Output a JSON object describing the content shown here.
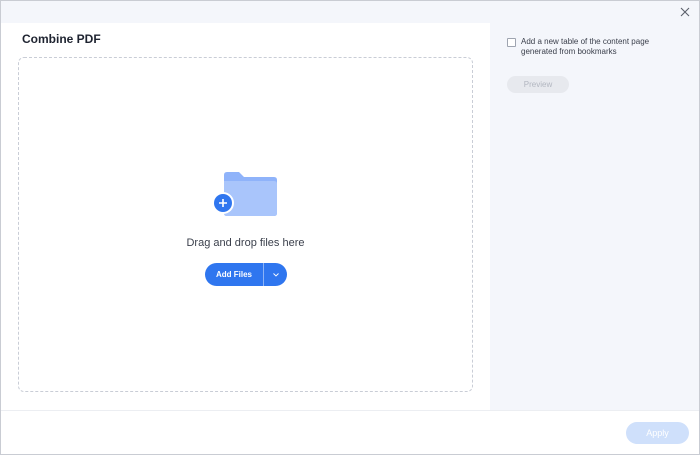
{
  "window": {
    "title": "Combine PDF"
  },
  "dropzone": {
    "text": "Drag and drop files here",
    "add_files_label": "Add Files"
  },
  "sidebar": {
    "toc_label": "Add a new table of the content page generated from bookmarks",
    "toc_checked": false,
    "preview_label": "Preview"
  },
  "footer": {
    "apply_label": "Apply"
  },
  "colors": {
    "accent": "#2f76ef",
    "sidebar_bg": "#f4f6fb",
    "disabled_apply": "#cfe0fb"
  },
  "icons": {
    "close": "close-icon",
    "folder": "folder-icon",
    "plus": "plus-icon",
    "dropdown": "chevron-down-icon"
  }
}
